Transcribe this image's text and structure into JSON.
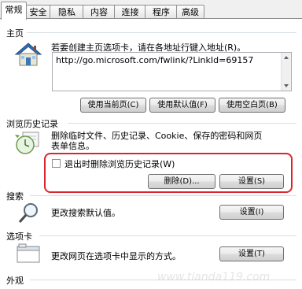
{
  "tabs": [
    "常规",
    "安全",
    "隐私",
    "内容",
    "连接",
    "程序",
    "高级"
  ],
  "active_tab": "常规",
  "home_page": {
    "title": "主页",
    "description": "若要创建主页选项卡，请在各地址行键入地址(R)。",
    "url": "http://go.microsoft.com/fwlink/?LinkId=69157",
    "buttons": [
      "使用当前页(C)",
      "使用默认值(F)",
      "使用空白页(B)"
    ]
  },
  "browsing_history": {
    "title": "浏览历史记录",
    "description_line1": "删除临时文件、历史记录、Cookie、保存的密码和网页",
    "description_line2": "表单信息。",
    "checkbox_label": "退出时删除浏览历史记录(W)",
    "checkbox_checked": false,
    "delete_button": "删除(D)...",
    "settings_button": "设置(S)"
  },
  "search": {
    "title": "搜索",
    "description": "更改搜索默认值。",
    "settings_button": "设置(I)"
  },
  "tabs_section": {
    "title": "选项卡",
    "description": "更改网页在选项卡中显示的方式。",
    "settings_button": "设置(T)"
  },
  "appearance": {
    "title": "外观"
  },
  "watermark": "www.tianda119.com",
  "colors": {
    "highlight": "#d9262c",
    "separator": "#d5dfe5"
  }
}
